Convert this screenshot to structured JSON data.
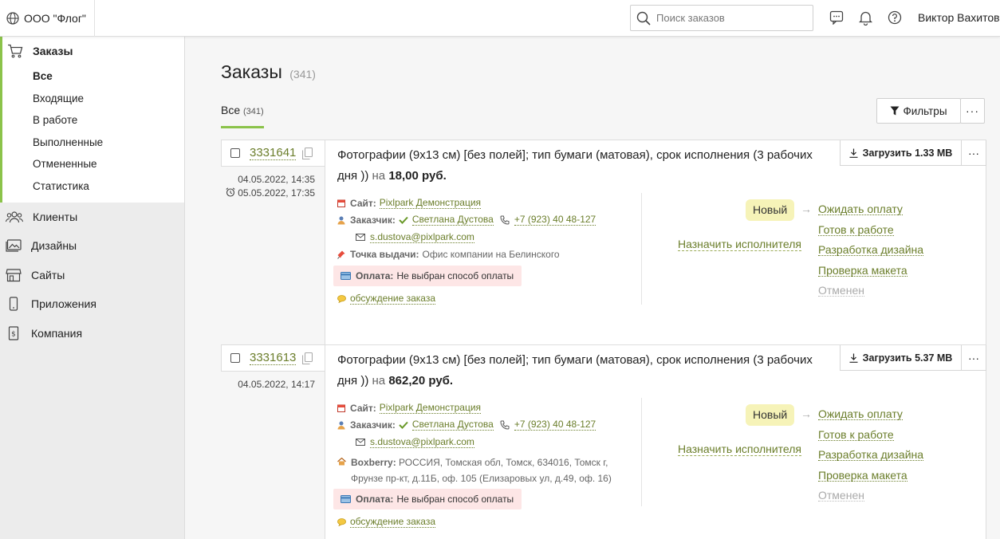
{
  "org": {
    "name": "ООО \"Флог\""
  },
  "search": {
    "placeholder": "Поиск заказов"
  },
  "user": {
    "name": "Виктор Вахитов"
  },
  "sidebar": {
    "orders_label": "Заказы",
    "sub_items": [
      "Все",
      "Входящие",
      "В работе",
      "Выполненные",
      "Отмененные",
      "Статистика"
    ],
    "items": [
      {
        "label": "Клиенты",
        "icon": "users-icon"
      },
      {
        "label": "Дизайны",
        "icon": "image-icon"
      },
      {
        "label": "Сайты",
        "icon": "store-icon"
      },
      {
        "label": "Приложения",
        "icon": "phone-icon"
      },
      {
        "label": "Компания",
        "icon": "document-icon"
      }
    ]
  },
  "main": {
    "title": "Заказы",
    "title_count": "(341)",
    "tab_label": "Все",
    "tab_count": "(341)",
    "filters_label": "Фильтры",
    "more_label": "···"
  },
  "orders": [
    {
      "number": "3331641",
      "created": "04.05.2022, 14:35",
      "deadline": "05.05.2022, 17:35",
      "title": "Фотографии (9x13 см) [без полей]; тип бумаги (матовая), срок исполнения (3 рабочих дня ))",
      "na": "на",
      "price": "18,00 руб.",
      "download": "Загрузить 1.33 MB",
      "site_label": "Сайт:",
      "site": "Pixlpark Демонстрация",
      "customer_label": "Заказчик:",
      "customer": "Светлана Дустова",
      "phone": "+7 (923) 40 48-127",
      "email": "s.dustova@pixlpark.com",
      "delivery_label": "Точка выдачи:",
      "delivery": "Офис компании на Белинского",
      "payment_label": "Оплата:",
      "payment": "Не выбран способ оплаты",
      "discuss": "обсуждение заказа",
      "assign": "Назначить исполнителя",
      "status": "Новый",
      "next_statuses": [
        "Ожидать оплату",
        "Готов к работе",
        "Разработка дизайна",
        "Проверка макета",
        "Отменен"
      ]
    },
    {
      "number": "3331613",
      "created": "04.05.2022, 14:17",
      "title": "Фотографии (9x13 см) [без полей]; тип бумаги (матовая), срок исполнения (3 рабочих дня ))",
      "na": "на",
      "price": "862,20 руб.",
      "download": "Загрузить 5.37 MB",
      "site_label": "Сайт:",
      "site": "Pixlpark Демонстрация",
      "customer_label": "Заказчик:",
      "customer": "Светлана Дустова",
      "phone": "+7 (923) 40 48-127",
      "email": "s.dustova@pixlpark.com",
      "delivery_label": "Boxberry:",
      "delivery": "РОССИЯ, Томская обл, Томск, 634016, Томск г, Фрунзе пр-кт, д.11Б, оф. 105 (Елизаровых ул, д.49, оф. 16)",
      "payment_label": "Оплата:",
      "payment": "Не выбран способ оплаты",
      "discuss": "обсуждение заказа",
      "assign": "Назначить исполнителя",
      "status": "Новый",
      "next_statuses": [
        "Ожидать оплату",
        "Готов к работе",
        "Разработка дизайна",
        "Проверка макета",
        "Отменен"
      ]
    }
  ],
  "colors": {
    "accent": "#8bc34a",
    "link": "#6b7e2b",
    "status_badge": "#f6f3b8",
    "payment_bg": "#fde6e6"
  }
}
